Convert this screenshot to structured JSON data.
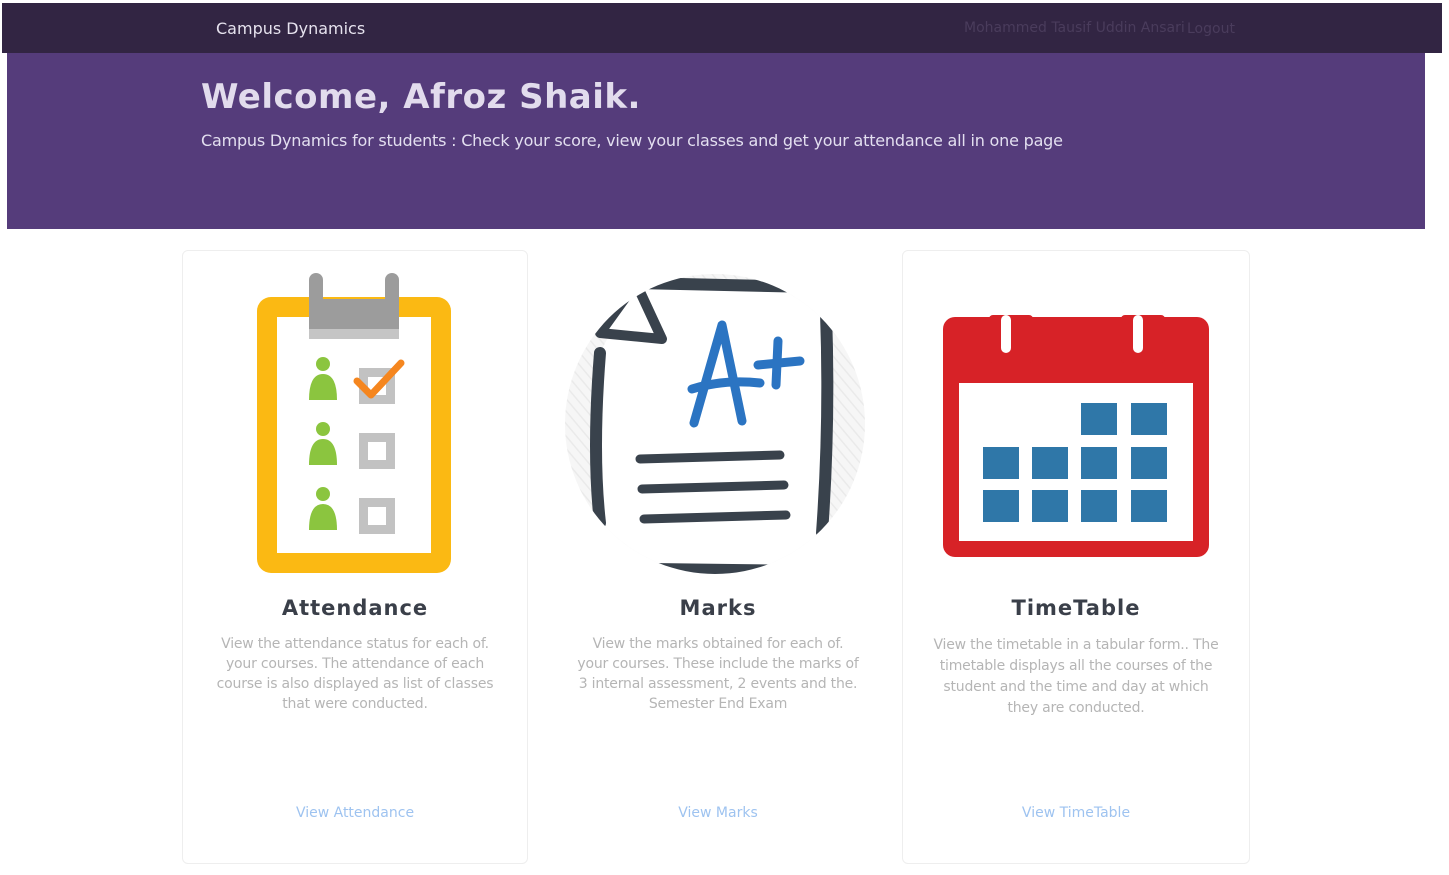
{
  "navbar": {
    "brand": "Campus Dynamics",
    "user_name": "Mohammed Tausif Uddin Ansari",
    "logout_label": "Logout"
  },
  "hero": {
    "title": "Welcome, Afroz Shaik.",
    "subtitle": "Campus Dynamics for students : Check your score, view your classes and get your attendance all in one page"
  },
  "cards": [
    {
      "icon": "attendance-clipboard-icon",
      "title": "Attendance",
      "text": "View the attendance status for each of. your courses. The attendance of each course is also displayed as list of classes that were conducted.",
      "link": "View Attendance"
    },
    {
      "icon": "marks-paper-icon",
      "title": "Marks",
      "text": "View the marks obtained for each of. your courses. These include the marks of 3 internal assessment, 2 events and the. Semester End Exam",
      "link": "View Marks"
    },
    {
      "icon": "calendar-icon",
      "title": "TimeTable",
      "text": "View the timetable in a tabular form.. The timetable displays all the courses of the student and the time and day at which they are conducted.",
      "link": "View TimeTable"
    }
  ],
  "colors": {
    "navbar": "#322543",
    "hero": "#553c7b",
    "link": "#9ec3f0",
    "clipboard": "#fbb913",
    "calendar_red": "#d72227",
    "calendar_blue": "#2f77a8"
  }
}
